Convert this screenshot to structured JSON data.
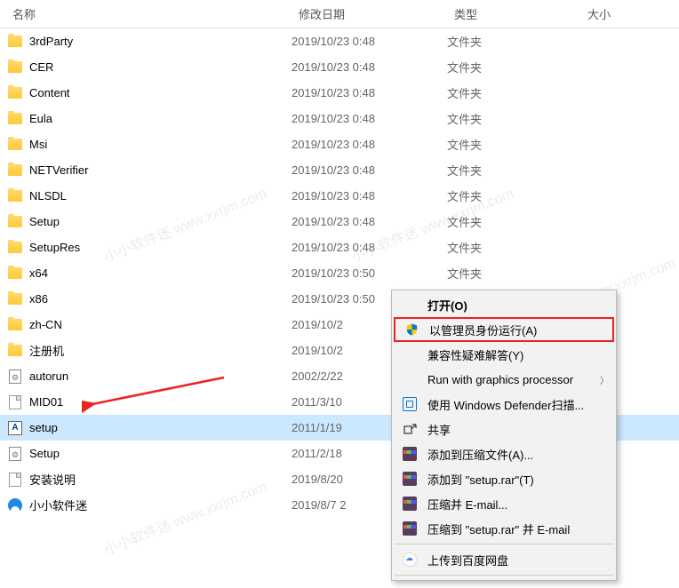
{
  "header": {
    "name": "名称",
    "date": "修改日期",
    "type": "类型",
    "size": "大小"
  },
  "files": [
    {
      "icon": "folder",
      "name": "3rdParty",
      "date": "2019/10/23 0:48",
      "type": "文件夹"
    },
    {
      "icon": "folder",
      "name": "CER",
      "date": "2019/10/23 0:48",
      "type": "文件夹"
    },
    {
      "icon": "folder",
      "name": "Content",
      "date": "2019/10/23 0:48",
      "type": "文件夹"
    },
    {
      "icon": "folder",
      "name": "Eula",
      "date": "2019/10/23 0:48",
      "type": "文件夹"
    },
    {
      "icon": "folder",
      "name": "Msi",
      "date": "2019/10/23 0:48",
      "type": "文件夹"
    },
    {
      "icon": "folder",
      "name": "NETVerifier",
      "date": "2019/10/23 0:48",
      "type": "文件夹"
    },
    {
      "icon": "folder",
      "name": "NLSDL",
      "date": "2019/10/23 0:48",
      "type": "文件夹"
    },
    {
      "icon": "folder",
      "name": "Setup",
      "date": "2019/10/23 0:48",
      "type": "文件夹"
    },
    {
      "icon": "folder",
      "name": "SetupRes",
      "date": "2019/10/23 0:48",
      "type": "文件夹"
    },
    {
      "icon": "folder",
      "name": "x64",
      "date": "2019/10/23 0:50",
      "type": "文件夹"
    },
    {
      "icon": "folder",
      "name": "x86",
      "date": "2019/10/23 0:50",
      "type": "文件夹"
    },
    {
      "icon": "folder",
      "name": "zh-CN",
      "date": "2019/10/2",
      "type": ""
    },
    {
      "icon": "folder",
      "name": "注册机",
      "date": "2019/10/2",
      "type": ""
    },
    {
      "icon": "config",
      "name": "autorun",
      "date": "2002/2/22",
      "type": ""
    },
    {
      "icon": "file",
      "name": "MID01",
      "date": "2011/3/10",
      "type": ""
    },
    {
      "icon": "app",
      "name": "setup",
      "date": "2011/1/19",
      "type": "",
      "selected": true
    },
    {
      "icon": "config",
      "name": "Setup",
      "date": "2011/2/18",
      "type": ""
    },
    {
      "icon": "file",
      "name": "安装说明",
      "date": "2019/8/20",
      "type": ""
    },
    {
      "icon": "browser",
      "name": "小小软件迷",
      "date": "2019/8/7 2",
      "type": ""
    }
  ],
  "contextMenu": {
    "open": "打开(O)",
    "runAdmin": "以管理员身份运行(A)",
    "compatibility": "兼容性疑难解答(Y)",
    "runGraphics": "Run with graphics processor",
    "defender": "使用 Windows Defender扫描...",
    "share": "共享",
    "addArchive": "添加到压缩文件(A)...",
    "addSetupRar": "添加到 \"setup.rar\"(T)",
    "compressEmail": "压缩并 E-mail...",
    "compressSetupEmail": "压缩到 \"setup.rar\" 并 E-mail",
    "baidu": "上传到百度网盘"
  },
  "watermark": "小小软件迷 www.xxrjm.com"
}
